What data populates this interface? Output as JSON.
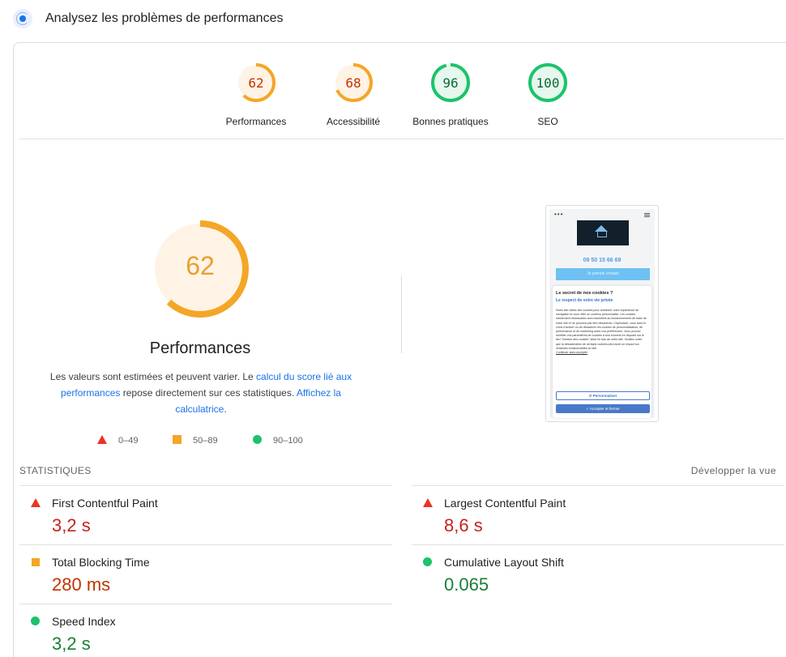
{
  "header": {
    "title": "Analysez les problèmes de performances"
  },
  "gauges": [
    {
      "score": "62",
      "value": 62,
      "label": "Performances",
      "color": "#f4a626",
      "text_color": "#c33300",
      "bg": "#fff3e6"
    },
    {
      "score": "68",
      "value": 68,
      "label": "Accessibilité",
      "color": "#f4a626",
      "text_color": "#c33300",
      "bg": "#fff3e6"
    },
    {
      "score": "96",
      "value": 96,
      "label": "Bonnes pratiques",
      "color": "#1cc36a",
      "text_color": "#0b6b34",
      "bg": "#e6f7ee"
    },
    {
      "score": "100",
      "value": 100,
      "label": "SEO",
      "color": "#1cc36a",
      "text_color": "#0b6b34",
      "bg": "#e6f7ee"
    }
  ],
  "performance": {
    "score": "62",
    "value": 62,
    "title": "Performances",
    "desc_1": "Les valeurs sont estimées et peuvent varier. Le ",
    "link_1": "calcul du score lié aux performances",
    "desc_2": " repose directement sur ces statistiques. ",
    "link_2": "Affichez la calculatrice",
    "desc_3": "."
  },
  "legend": {
    "red": "0–49",
    "orange": "50–89",
    "green": "90–100"
  },
  "screenshot": {
    "dots": "•••",
    "phone": "09 50 15 66 69",
    "button": "Je prends contact",
    "modal_title": "Le secret de nos cookies ?",
    "modal_subtitle": "Le respect de votre vie privée",
    "modal_text": "Notre site utilise des cookies pour améliorer votre expérience de navigation et vous offrir un contenu personnalisé. Les cookies strictement nécessaires sont essentiels au fonctionnement de base de notre site et ne peuvent pas être désactivés. Cependant, vous avez le choix d'activer ou de désactiver les cookies de personnalisation, de performance et de marketing selon vos préférences. Vous pouvez modifier vos paramètres de cookies à tout moment en cliquant sur le lien \"Gestion des cookies\" situé en bas de notre site. Veuillez noter que la désactivation de certains cookies peut avoir un impact sur certaines fonctionnalités du site.",
    "modal_link": "Continuer sans accepter",
    "btn_customize": "⚙ Personnaliser",
    "btn_accept": "✓ Accepter et fermer"
  },
  "stats": {
    "heading": "STATISTIQUES",
    "expand": "Développer la vue",
    "metrics": [
      {
        "name": "First Contentful Paint",
        "value": "3,2 s",
        "status": "red"
      },
      {
        "name": "Largest Contentful Paint",
        "value": "8,6 s",
        "status": "red"
      },
      {
        "name": "Total Blocking Time",
        "value": "280 ms",
        "status": "orange"
      },
      {
        "name": "Cumulative Layout Shift",
        "value": "0.065",
        "status": "green"
      },
      {
        "name": "Speed Index",
        "value": "3,2 s",
        "status": "green"
      }
    ]
  }
}
